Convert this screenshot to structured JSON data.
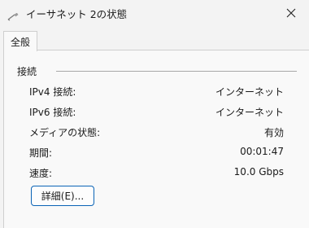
{
  "window": {
    "title": "イーサネット 2の状態",
    "icon": "network-cable-icon"
  },
  "tabs": [
    {
      "label": "全般"
    }
  ],
  "group": {
    "label": "接続"
  },
  "rows": [
    {
      "label": "IPv4 接続:",
      "value": "インターネット"
    },
    {
      "label": "IPv6 接続:",
      "value": "インターネット"
    },
    {
      "label": "メディアの状態:",
      "value": "有効"
    },
    {
      "label": "期間:",
      "value": "00:01:47"
    },
    {
      "label": "速度:",
      "value": "10.0 Gbps"
    }
  ],
  "buttons": {
    "details": "詳細(E)..."
  }
}
